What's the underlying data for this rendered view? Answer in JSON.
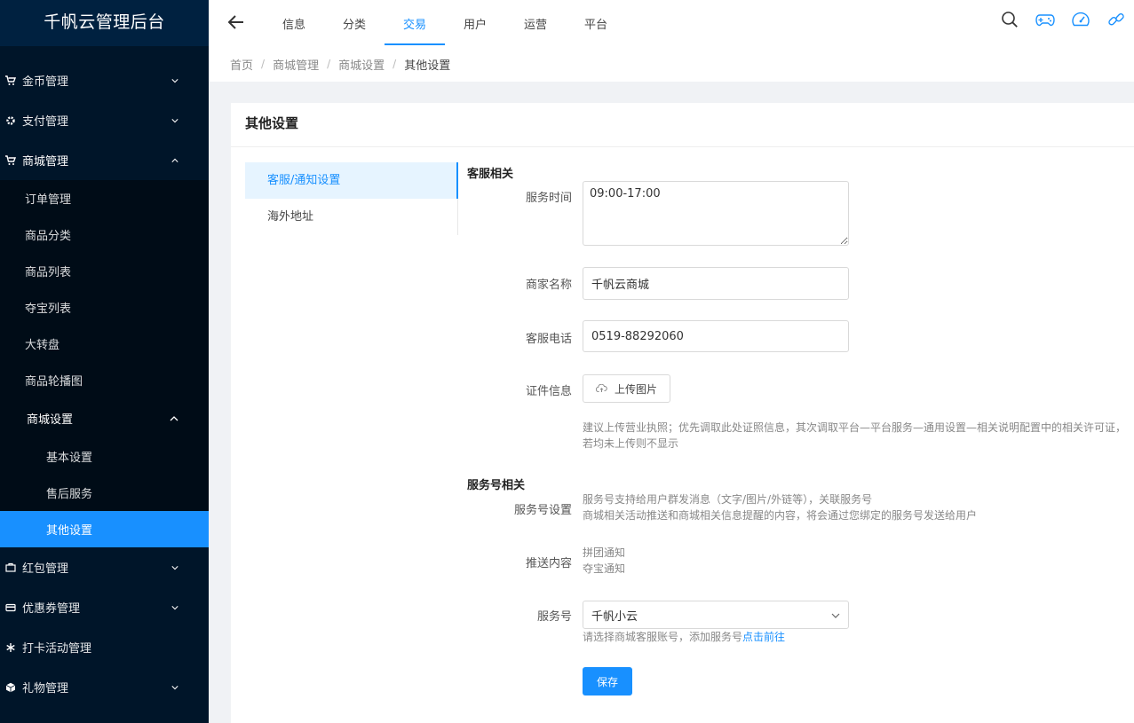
{
  "app": {
    "title": "千帆云管理后台"
  },
  "sidebar": {
    "items": [
      {
        "label": "金币管理",
        "icon": "cart-icon"
      },
      {
        "label": "支付管理",
        "icon": "gear-icon"
      },
      {
        "label": "商城管理",
        "icon": "cart-icon",
        "expanded": true
      },
      {
        "label": "红包管理",
        "icon": "calendar-icon"
      },
      {
        "label": "优惠券管理",
        "icon": "card-icon"
      },
      {
        "label": "打卡活动管理",
        "icon": "asterisk-icon"
      },
      {
        "label": "礼物管理",
        "icon": "cube-icon"
      }
    ],
    "mall_sub": [
      "订单管理",
      "商品分类",
      "商品列表",
      "夺宝列表",
      "大转盘",
      "商品轮播图"
    ],
    "mall_settings": {
      "label": "商城设置",
      "children": [
        "基本设置",
        "售后服务",
        "其他设置"
      ],
      "active_index": 2
    }
  },
  "header": {
    "tabs": [
      "信息",
      "分类",
      "交易",
      "用户",
      "运营",
      "平台"
    ],
    "active_tab": 2,
    "icons": [
      "search-icon",
      "gamepad-icon",
      "dashboard-icon",
      "link-icon"
    ]
  },
  "breadcrumb": [
    "首页",
    "商城管理",
    "商城设置",
    "其他设置"
  ],
  "page": {
    "title": "其他设置",
    "vtabs": [
      "客服/通知设置",
      "海外地址"
    ],
    "active_vtab": 0,
    "section1": "客服相关",
    "service_time_label": "服务时间",
    "service_time_value": "09:00-17:00",
    "merchant_name_label": "商家名称",
    "merchant_name_value": "千帆云商城",
    "phone_label": "客服电话",
    "phone_value": "0519-88292060",
    "cert_label": "证件信息",
    "upload_label": "上传图片",
    "cert_hint_line1": "建议上传营业执照；优先调取此处证照信息，其次调取平台—平台服务—通用设置—相关说明配置中的相关许可证，",
    "cert_hint_line2": "若均未上传则不显示",
    "section2": "服务号相关",
    "service_account_setting_label": "服务号设置",
    "service_account_desc_line1": "服务号支持给用户群发消息（文字/图片/外链等），关联服务号",
    "service_account_desc_line2": "商城相关活动推送和商城相关信息提醒的内容，将会通过您绑定的服务号发送给用户",
    "push_label": "推送内容",
    "push_items": [
      "拼团通知",
      "夺宝通知"
    ],
    "service_account_label": "服务号",
    "service_account_value": "千帆小云",
    "service_account_hint": "请选择商城客服账号，添加服务号",
    "service_account_link": "点击前往",
    "save_label": "保存"
  },
  "colors": {
    "primary": "#1890ff",
    "sidebar_bg": "#001529",
    "sidebar_sub_bg": "#000c17"
  }
}
